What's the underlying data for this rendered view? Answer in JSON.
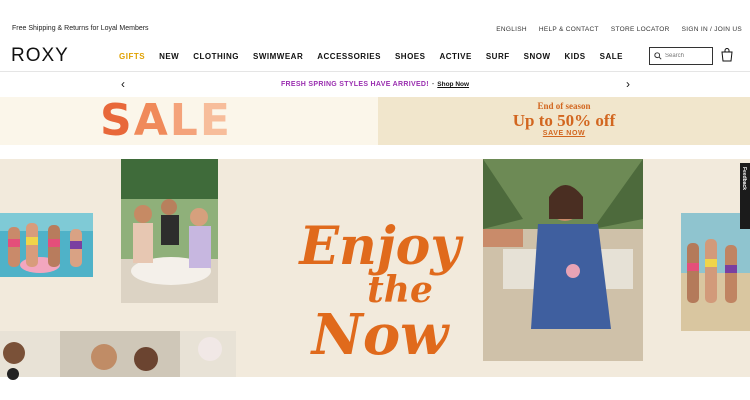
{
  "utility": {
    "shipping": "Free Shipping & Returns for Loyal Members",
    "links": [
      "ENGLISH",
      "HELP & CONTACT",
      "STORE LOCATOR",
      "SIGN IN / JOIN US"
    ]
  },
  "header": {
    "logo": "ROXY",
    "nav": [
      "GIFTS",
      "NEW",
      "CLOTHING",
      "SWIMWEAR",
      "ACCESSORIES",
      "SHOES",
      "ACTIVE",
      "SURF",
      "SNOW",
      "KIDS",
      "SALE"
    ],
    "search_placeholder": "Search"
  },
  "promo": {
    "message": "FRESH SPRING STYLES HAVE ARRIVED!",
    "separator": "-",
    "link": "Shop Now"
  },
  "sale_banner": {
    "word": "SALE",
    "subtitle": "End of season",
    "headline": "Up to 50% off",
    "cta": "SAVE NOW"
  },
  "hero": {
    "line1": "Enjoy",
    "line2": "the",
    "line3": "Now"
  },
  "feedback_label": "Feedback",
  "colors": {
    "gifts": "#e0a100",
    "promo": "#9a2fb0",
    "sale_orange": "#e8683a",
    "hero_orange": "#e06a1c",
    "hero_bg": "#f2eadc"
  }
}
